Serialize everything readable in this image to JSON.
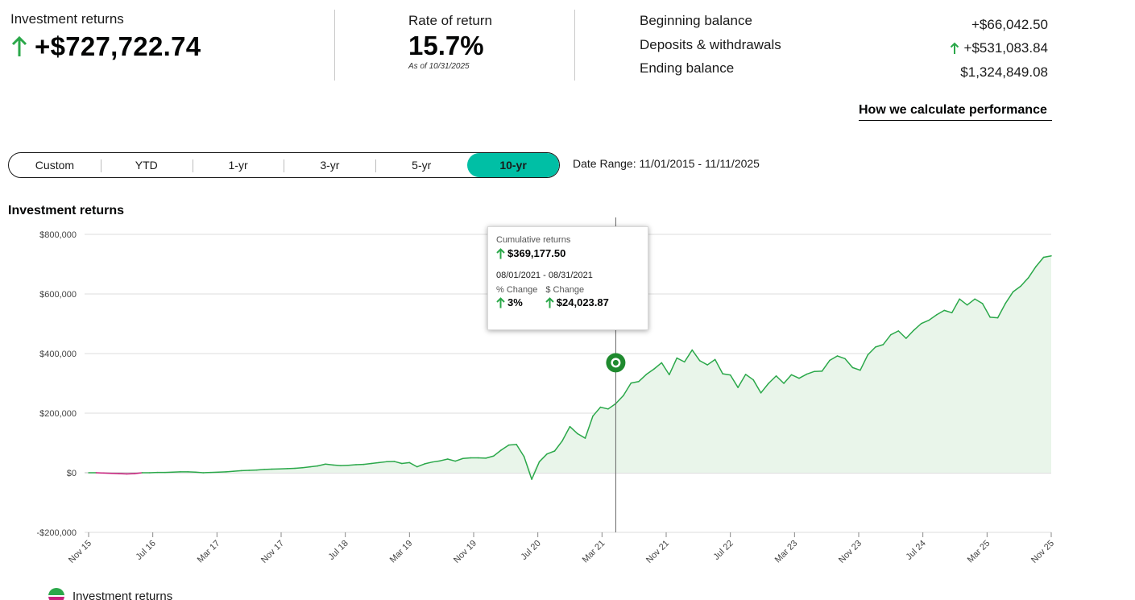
{
  "summary": {
    "returns_label": "Investment returns",
    "returns_value": "+$727,722.74",
    "rate_label": "Rate of return",
    "rate_value": "15.7%",
    "rate_asof": "As of 10/31/2025",
    "balances": [
      {
        "label": "Beginning balance",
        "value": "+$66,042.50",
        "arrow": false
      },
      {
        "label": "Deposits & withdrawals",
        "value": "+$531,083.84",
        "arrow": true
      },
      {
        "label": "Ending balance",
        "value": "$1,324,849.08",
        "arrow": false
      }
    ]
  },
  "how_link": "How we calculate performance",
  "ranges": [
    "Custom",
    "YTD",
    "1-yr",
    "3-yr",
    "5-yr",
    "10-yr"
  ],
  "active_range": "10-yr",
  "date_range": "Date Range: 11/01/2015 - 11/11/2025",
  "chart_title": "Investment returns",
  "tooltip": {
    "cum_label": "Cumulative returns",
    "cum_value": "$369,177.50",
    "dates": "08/01/2021 - 08/31/2021",
    "pct_label": "% Change",
    "usd_label": "$ Change",
    "pct_value": "3%",
    "usd_value": "$24,023.87"
  },
  "legend_label": "Investment returns",
  "colors": {
    "positive_line": "#2ba84a",
    "negative_line": "#c8207d",
    "area_fill": "#e9f5ea",
    "accent": "#00bfa5",
    "arrow_green": "#2ba84a"
  },
  "chart_data": {
    "type": "area",
    "title": "Investment returns",
    "ylim": [
      -200000,
      800000
    ],
    "yticks": [
      800000,
      600000,
      400000,
      200000,
      0,
      -200000
    ],
    "ytick_labels": [
      "$800,000",
      "$600,000",
      "$400,000",
      "$200,000",
      "$0",
      "-$200,000"
    ],
    "xtick_labels": [
      "Nov 15",
      "Jul 16",
      "Mar 17",
      "Nov 17",
      "Jul 18",
      "Mar 19",
      "Nov 19",
      "Jul 20",
      "Mar 21",
      "Nov 21",
      "Jul 22",
      "Mar 23",
      "Nov 23",
      "Jul 24",
      "Mar 25",
      "Nov 25"
    ],
    "grid": true,
    "highlight_month": 69,
    "highlight_value": 369177.5,
    "series": [
      {
        "name": "Investment returns",
        "values": [
          0,
          0,
          -1000,
          -2000,
          -3000,
          -4000,
          -3000,
          0,
          0,
          1000,
          1000,
          2000,
          3000,
          3000,
          2000,
          0,
          1000,
          2000,
          3000,
          5000,
          7000,
          8000,
          9000,
          11000,
          12000,
          13000,
          14000,
          15000,
          17000,
          20000,
          23000,
          29000,
          26000,
          24000,
          25000,
          27000,
          28000,
          31000,
          34000,
          37000,
          38000,
          31000,
          34000,
          20000,
          30000,
          36000,
          40000,
          46000,
          39000,
          48000,
          50000,
          50000,
          49000,
          56000,
          76000,
          93000,
          95000,
          54000,
          -22000,
          37000,
          63000,
          73000,
          107000,
          155000,
          131000,
          116000,
          190000,
          220000,
          214000,
          232000,
          259000,
          301000,
          306000,
          330000,
          348000,
          369177,
          329000,
          385000,
          372000,
          412000,
          376000,
          362000,
          380000,
          332000,
          328000,
          286000,
          330000,
          312000,
          268000,
          300000,
          325000,
          300000,
          329000,
          317000,
          331000,
          340000,
          341000,
          377000,
          392000,
          383000,
          353000,
          344000,
          396000,
          422000,
          430000,
          463000,
          476000,
          451000,
          478000,
          501000,
          512000,
          530000,
          545000,
          537000,
          583000,
          563000,
          583000,
          568000,
          522000,
          520000,
          568000,
          607000,
          626000,
          654000,
          692000,
          723000,
          727722
        ]
      }
    ]
  }
}
